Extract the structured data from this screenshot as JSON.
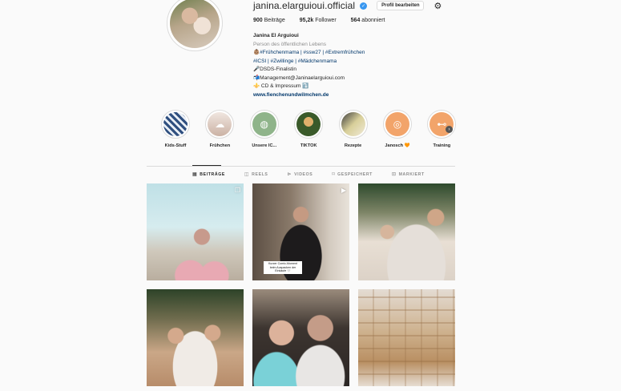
{
  "profile": {
    "username": "janina.elarguioui.official",
    "edit_button": "Profil bearbeiten",
    "stats": [
      {
        "count": "900",
        "label": "Beiträge"
      },
      {
        "count": "95,2k",
        "label": "Follower"
      },
      {
        "count": "564",
        "label": "abonniert"
      }
    ],
    "full_name": "Janina El Arguioui",
    "category": "Person des öffentlichen Lebens",
    "bio_lines": [
      "👶🏽#Frühchenmama | #ssw27 | #Extremfrühchen",
      "#ICSI | #Zwillinge | #Mädchenmama",
      "🎤DSDS-Finalistin",
      "📬Management@Janinaelarguioui.com",
      "⚜️ CD & Impressum ⤵️"
    ],
    "website": "www.fienchenundwilmchen.de"
  },
  "highlights": [
    {
      "label": "Kids-Stuff"
    },
    {
      "label": "Frühchen"
    },
    {
      "label": "Unsere IC..."
    },
    {
      "label": "TIKTOK"
    },
    {
      "label": "Rezepte"
    },
    {
      "label": "Janosch 🧡"
    },
    {
      "label": "Training"
    }
  ],
  "tabs": [
    {
      "label": "BEITRÄGE",
      "icon": "grid-icon"
    },
    {
      "label": "REELS",
      "icon": "reels-icon"
    },
    {
      "label": "VIDEOS",
      "icon": "video-icon"
    },
    {
      "label": "GESPEICHERT",
      "icon": "bookmark-icon"
    },
    {
      "label": "MARKIERT",
      "icon": "tag-icon"
    }
  ],
  "posts": [
    {
      "type": "carousel"
    },
    {
      "type": "reel",
      "caption": "Kurzer Comic-Moment beim Auspacken der Einkäufe 🤍"
    },
    {
      "type": "photo"
    },
    {
      "type": "photo"
    },
    {
      "type": "photo"
    },
    {
      "type": "photo"
    }
  ],
  "colors": {
    "link": "#00376b",
    "verified": "#3897f0",
    "border": "#dbdbdb",
    "muted": "#8e8e8e",
    "background": "#fafafa"
  }
}
